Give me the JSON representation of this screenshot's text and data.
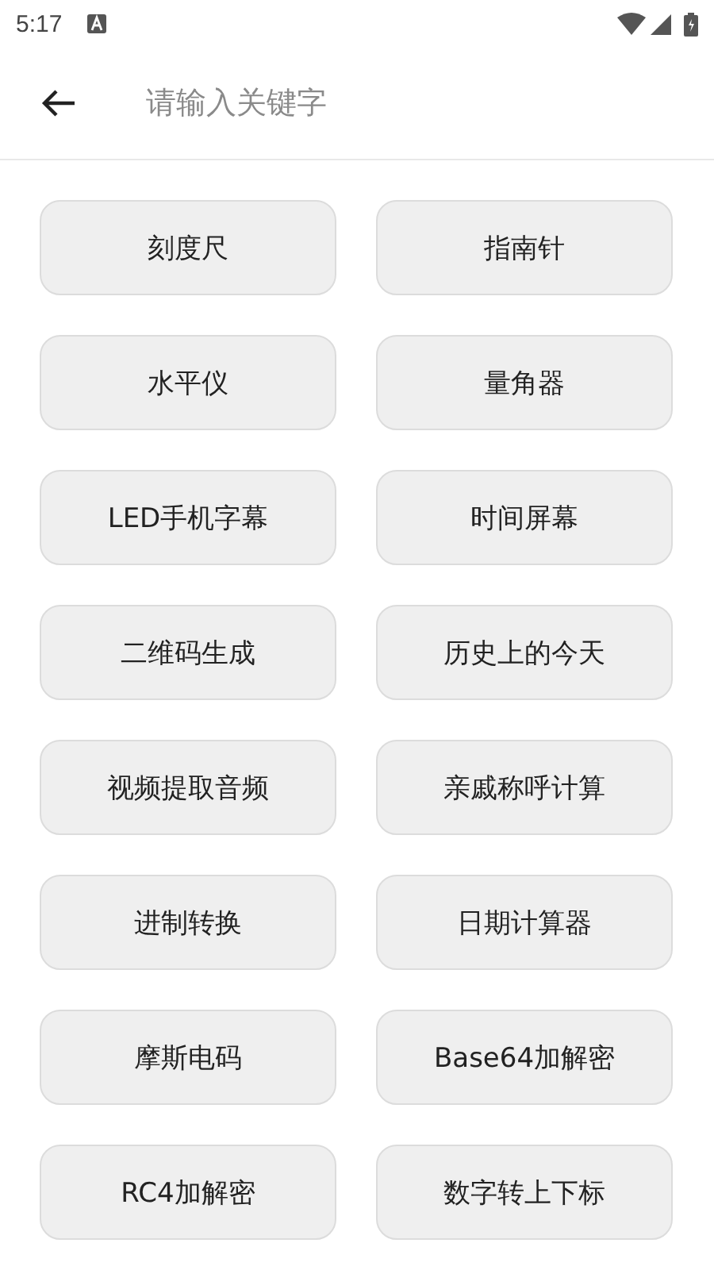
{
  "status_bar": {
    "time": "5:17"
  },
  "search": {
    "placeholder": "请输入关键字"
  },
  "tools": [
    "刻度尺",
    "指南针",
    "水平仪",
    "量角器",
    "LED手机字幕",
    "时间屏幕",
    "二维码生成",
    "历史上的今天",
    "视频提取音频",
    "亲戚称呼计算",
    "进制转换",
    "日期计算器",
    "摩斯电码",
    "Base64加解密",
    "RC4加解密",
    "数字转上下标"
  ]
}
